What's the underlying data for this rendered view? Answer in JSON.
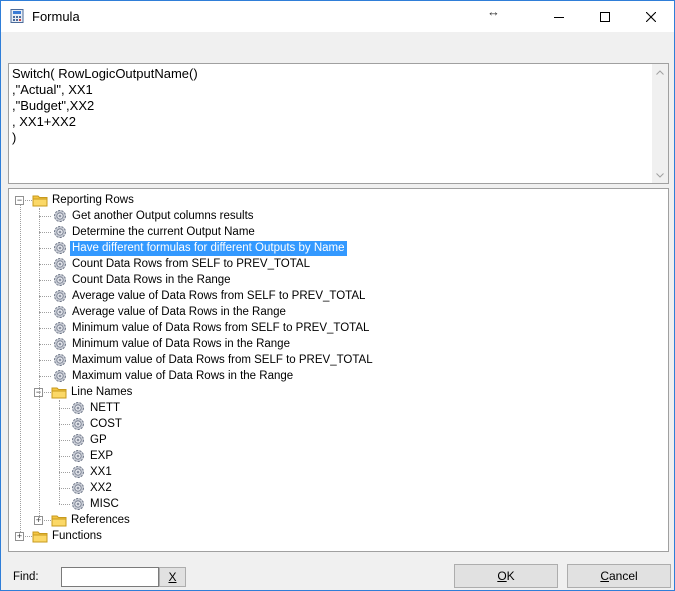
{
  "window": {
    "title": "Formula",
    "resize_glyph": "↔"
  },
  "formula": {
    "text": "Switch( RowLogicOutputName()\n,\"Actual\", XX1\n,\"Budget\",XX2\n, XX1+XX2\n)"
  },
  "tree": {
    "reporting_rows": {
      "label": "Reporting Rows",
      "items": [
        "Get another Output columns results",
        "Determine the current Output Name",
        "Have different formulas for different Outputs by Name",
        "Count Data Rows from SELF to PREV_TOTAL",
        "Count Data Rows in the Range",
        "Average value of Data Rows from SELF to PREV_TOTAL",
        "Average value of Data Rows in the Range",
        "Minimum value of Data Rows from SELF to PREV_TOTAL",
        "Minimum value of Data Rows in the Range",
        "Maximum value of Data Rows from SELF to PREV_TOTAL",
        "Maximum value of Data Rows in the Range"
      ],
      "selected_index": 2
    },
    "line_names": {
      "label": "Line Names",
      "items": [
        "NETT",
        "COST",
        "GP",
        "EXP",
        "XX1",
        "XX2",
        "MISC"
      ]
    },
    "references": {
      "label": "References"
    },
    "functions": {
      "label": "Functions"
    }
  },
  "footer": {
    "find_label": "Find:",
    "find_value": "",
    "clear_label": "X",
    "ok_label": "OK",
    "cancel_label": "Cancel"
  },
  "colors": {
    "selection": "#3399ff",
    "window_border": "#2f7ed8",
    "folder": "#f5c542"
  }
}
